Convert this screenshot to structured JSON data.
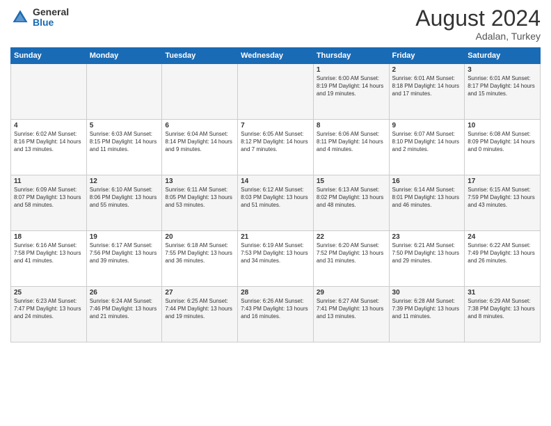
{
  "header": {
    "logo": {
      "general": "General",
      "blue": "Blue"
    },
    "title": "August 2024",
    "location": "Adalan, Turkey"
  },
  "weekdays": [
    "Sunday",
    "Monday",
    "Tuesday",
    "Wednesday",
    "Thursday",
    "Friday",
    "Saturday"
  ],
  "weeks": [
    [
      {
        "day": "",
        "text": ""
      },
      {
        "day": "",
        "text": ""
      },
      {
        "day": "",
        "text": ""
      },
      {
        "day": "",
        "text": ""
      },
      {
        "day": "1",
        "text": "Sunrise: 6:00 AM\nSunset: 8:19 PM\nDaylight: 14 hours\nand 19 minutes."
      },
      {
        "day": "2",
        "text": "Sunrise: 6:01 AM\nSunset: 8:18 PM\nDaylight: 14 hours\nand 17 minutes."
      },
      {
        "day": "3",
        "text": "Sunrise: 6:01 AM\nSunset: 8:17 PM\nDaylight: 14 hours\nand 15 minutes."
      }
    ],
    [
      {
        "day": "4",
        "text": "Sunrise: 6:02 AM\nSunset: 8:16 PM\nDaylight: 14 hours\nand 13 minutes."
      },
      {
        "day": "5",
        "text": "Sunrise: 6:03 AM\nSunset: 8:15 PM\nDaylight: 14 hours\nand 11 minutes."
      },
      {
        "day": "6",
        "text": "Sunrise: 6:04 AM\nSunset: 8:14 PM\nDaylight: 14 hours\nand 9 minutes."
      },
      {
        "day": "7",
        "text": "Sunrise: 6:05 AM\nSunset: 8:12 PM\nDaylight: 14 hours\nand 7 minutes."
      },
      {
        "day": "8",
        "text": "Sunrise: 6:06 AM\nSunset: 8:11 PM\nDaylight: 14 hours\nand 4 minutes."
      },
      {
        "day": "9",
        "text": "Sunrise: 6:07 AM\nSunset: 8:10 PM\nDaylight: 14 hours\nand 2 minutes."
      },
      {
        "day": "10",
        "text": "Sunrise: 6:08 AM\nSunset: 8:09 PM\nDaylight: 14 hours\nand 0 minutes."
      }
    ],
    [
      {
        "day": "11",
        "text": "Sunrise: 6:09 AM\nSunset: 8:07 PM\nDaylight: 13 hours\nand 58 minutes."
      },
      {
        "day": "12",
        "text": "Sunrise: 6:10 AM\nSunset: 8:06 PM\nDaylight: 13 hours\nand 55 minutes."
      },
      {
        "day": "13",
        "text": "Sunrise: 6:11 AM\nSunset: 8:05 PM\nDaylight: 13 hours\nand 53 minutes."
      },
      {
        "day": "14",
        "text": "Sunrise: 6:12 AM\nSunset: 8:03 PM\nDaylight: 13 hours\nand 51 minutes."
      },
      {
        "day": "15",
        "text": "Sunrise: 6:13 AM\nSunset: 8:02 PM\nDaylight: 13 hours\nand 48 minutes."
      },
      {
        "day": "16",
        "text": "Sunrise: 6:14 AM\nSunset: 8:01 PM\nDaylight: 13 hours\nand 46 minutes."
      },
      {
        "day": "17",
        "text": "Sunrise: 6:15 AM\nSunset: 7:59 PM\nDaylight: 13 hours\nand 43 minutes."
      }
    ],
    [
      {
        "day": "18",
        "text": "Sunrise: 6:16 AM\nSunset: 7:58 PM\nDaylight: 13 hours\nand 41 minutes."
      },
      {
        "day": "19",
        "text": "Sunrise: 6:17 AM\nSunset: 7:56 PM\nDaylight: 13 hours\nand 39 minutes."
      },
      {
        "day": "20",
        "text": "Sunrise: 6:18 AM\nSunset: 7:55 PM\nDaylight: 13 hours\nand 36 minutes."
      },
      {
        "day": "21",
        "text": "Sunrise: 6:19 AM\nSunset: 7:53 PM\nDaylight: 13 hours\nand 34 minutes."
      },
      {
        "day": "22",
        "text": "Sunrise: 6:20 AM\nSunset: 7:52 PM\nDaylight: 13 hours\nand 31 minutes."
      },
      {
        "day": "23",
        "text": "Sunrise: 6:21 AM\nSunset: 7:50 PM\nDaylight: 13 hours\nand 29 minutes."
      },
      {
        "day": "24",
        "text": "Sunrise: 6:22 AM\nSunset: 7:49 PM\nDaylight: 13 hours\nand 26 minutes."
      }
    ],
    [
      {
        "day": "25",
        "text": "Sunrise: 6:23 AM\nSunset: 7:47 PM\nDaylight: 13 hours\nand 24 minutes."
      },
      {
        "day": "26",
        "text": "Sunrise: 6:24 AM\nSunset: 7:46 PM\nDaylight: 13 hours\nand 21 minutes."
      },
      {
        "day": "27",
        "text": "Sunrise: 6:25 AM\nSunset: 7:44 PM\nDaylight: 13 hours\nand 19 minutes."
      },
      {
        "day": "28",
        "text": "Sunrise: 6:26 AM\nSunset: 7:43 PM\nDaylight: 13 hours\nand 16 minutes."
      },
      {
        "day": "29",
        "text": "Sunrise: 6:27 AM\nSunset: 7:41 PM\nDaylight: 13 hours\nand 13 minutes."
      },
      {
        "day": "30",
        "text": "Sunrise: 6:28 AM\nSunset: 7:39 PM\nDaylight: 13 hours\nand 11 minutes."
      },
      {
        "day": "31",
        "text": "Sunrise: 6:29 AM\nSunset: 7:38 PM\nDaylight: 13 hours\nand 8 minutes."
      }
    ]
  ]
}
